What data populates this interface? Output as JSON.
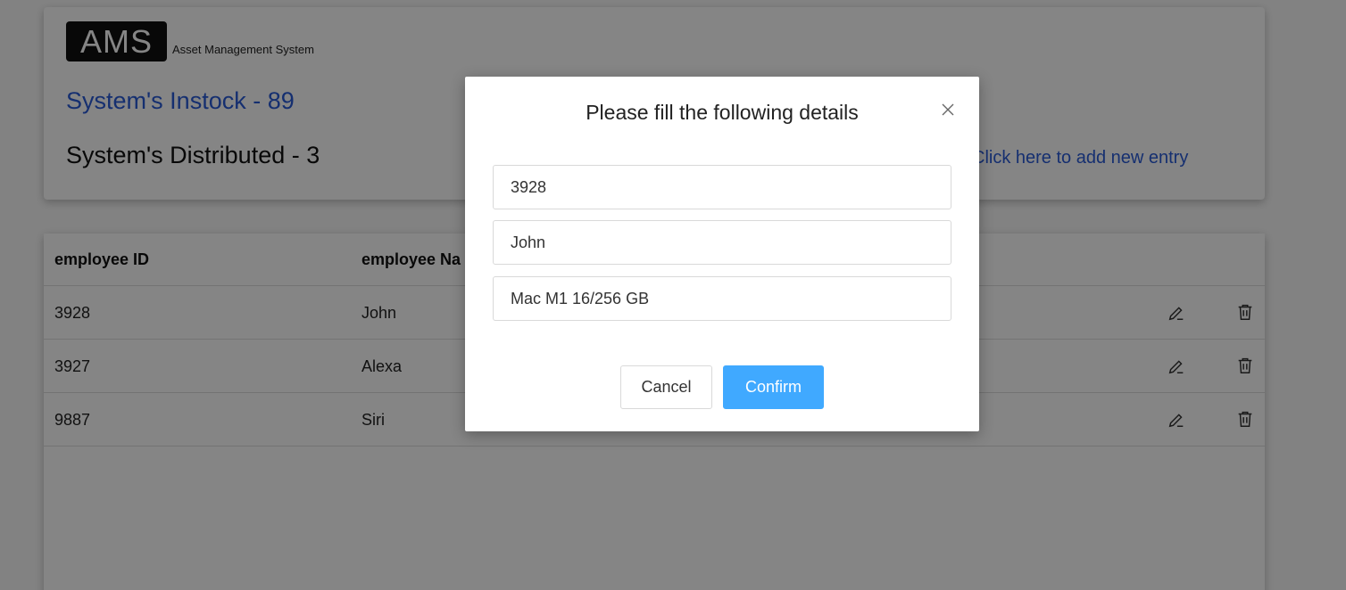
{
  "header": {
    "logo": "AMS",
    "logo_subtitle": "Asset Management System",
    "instock": "System's Instock - 89",
    "distributed": "System's Distributed - 3",
    "add_link": "Click here to add new entry"
  },
  "table": {
    "columns": [
      "employee ID",
      "employee Na"
    ],
    "rows": [
      {
        "id": "3928",
        "name": "John"
      },
      {
        "id": "3927",
        "name": "Alexa"
      },
      {
        "id": "9887",
        "name": "Siri"
      }
    ]
  },
  "modal": {
    "title": "Please fill the following details",
    "fields": [
      "3928",
      "John",
      "Mac M1 16/256 GB"
    ],
    "cancel_label": "Cancel",
    "confirm_label": "Confirm"
  },
  "colors": {
    "link": "#2a5bd7",
    "primary_button": "#40a9ff"
  },
  "icons": [
    "edit-icon",
    "delete-icon",
    "close-icon"
  ]
}
